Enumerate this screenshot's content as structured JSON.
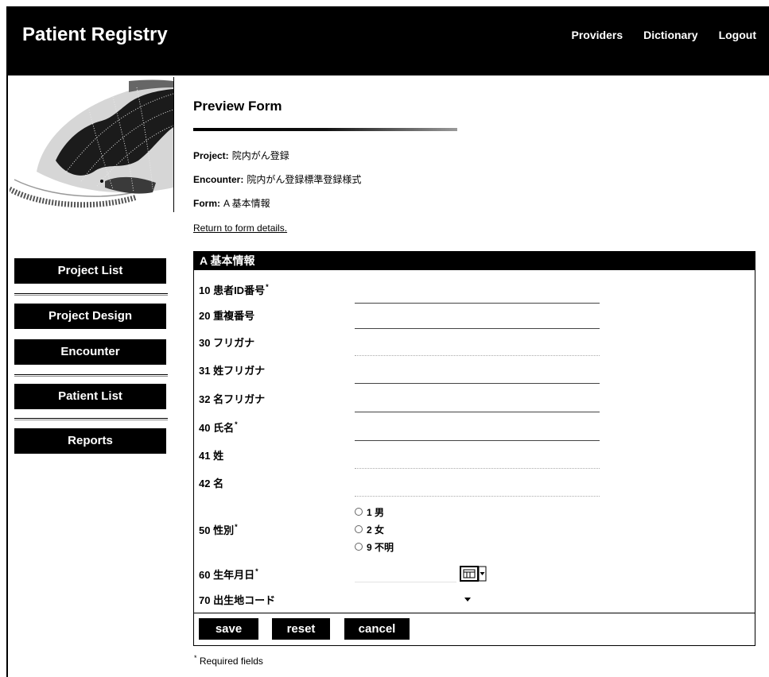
{
  "header": {
    "app_title": "Patient Registry",
    "nav": [
      {
        "label": "Providers"
      },
      {
        "label": "Dictionary"
      },
      {
        "label": "Logout"
      }
    ]
  },
  "sidebar": {
    "items": [
      {
        "label": "Project List"
      },
      {
        "label": "Project Design"
      },
      {
        "label": "Encounter"
      },
      {
        "label": "Patient List"
      },
      {
        "label": "Reports"
      }
    ]
  },
  "main": {
    "title": "Preview Form",
    "project": {
      "label": "Project:",
      "value": "院内がん登録"
    },
    "encounter": {
      "label": "Encounter:",
      "value": "院内がん登録標準登録様式"
    },
    "form": {
      "label": "Form:",
      "value": "A 基本情報"
    },
    "return_link": "Return to form details."
  },
  "form": {
    "section_title": "A 基本情報",
    "required_mark": "*",
    "fields": [
      {
        "label": "10 患者ID番号",
        "required": true
      },
      {
        "label": "20 重複番号",
        "required": false
      },
      {
        "label": "30 フリガナ",
        "required": false
      },
      {
        "label": "31 姓フリガナ",
        "required": false
      },
      {
        "label": "32 名フリガナ",
        "required": false
      },
      {
        "label": "40 氏名",
        "required": true
      },
      {
        "label": "41 姓",
        "required": false
      },
      {
        "label": "42 名",
        "required": false
      },
      {
        "label": "50 性別",
        "required": true,
        "options": [
          {
            "label": "1 男",
            "checked": false
          },
          {
            "label": "2 女",
            "checked": false
          },
          {
            "label": "9 不明",
            "checked": false
          }
        ]
      },
      {
        "label": "60 生年月日",
        "required": true
      },
      {
        "label": "70 出生地コード",
        "required": false
      }
    ],
    "buttons": {
      "save": "save",
      "reset": "reset",
      "cancel": "cancel"
    },
    "footnote": "Required fields"
  },
  "icons": {
    "calendar": "calendar-icon",
    "dropdown": "chevron-down-icon"
  },
  "colors": {
    "header_bg": "#000000",
    "button_bg": "#000000",
    "button_text": "#ffffff",
    "page_bg": "#ffffff"
  }
}
